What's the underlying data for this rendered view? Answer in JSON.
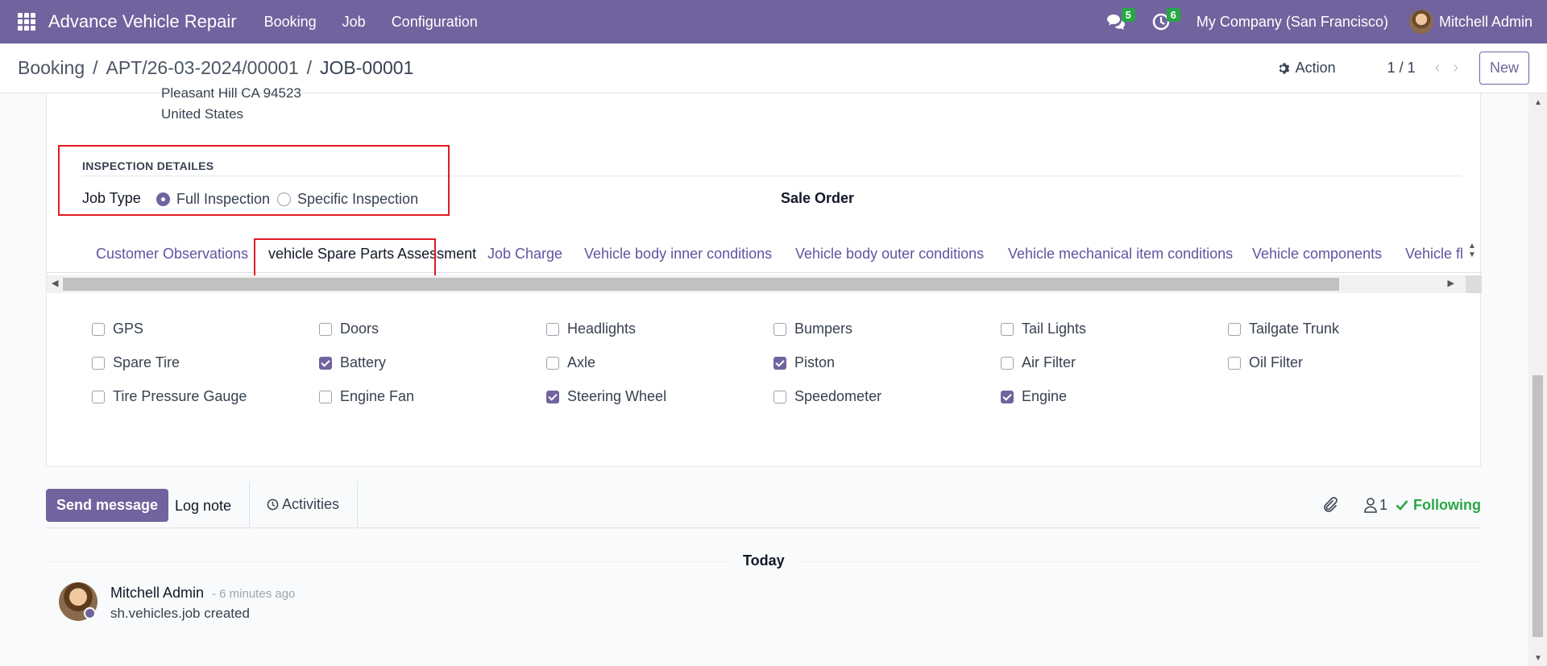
{
  "navbar": {
    "brand": "Advance Vehicle Repair",
    "menus": [
      "Booking",
      "Job",
      "Configuration"
    ],
    "messages_count": "5",
    "activities_count": "6",
    "company": "My Company (San Francisco)",
    "user": "Mitchell Admin"
  },
  "breadcrumb": {
    "items": [
      "Booking",
      "APT/26-03-2024/00001",
      "JOB-00001"
    ],
    "separator": "/"
  },
  "control": {
    "action_label": "Action",
    "pager": "1 / 1",
    "new_label": "New"
  },
  "address": {
    "line1": "Pleasant Hill CA 94523",
    "line2": "United States"
  },
  "inspection": {
    "title": "INSPECTION DETAILES",
    "job_type_label": "Job Type",
    "options": [
      "Full Inspection",
      "Specific Inspection"
    ],
    "selected": "Full Inspection",
    "sale_order_label": "Sale Order"
  },
  "tabs": [
    "Customer Observations",
    "vehicle Spare Parts Assessment",
    "Job Charge",
    "Vehicle body inner conditions",
    "Vehicle body outer conditions",
    "Vehicle mechanical item conditions",
    "Vehicle components",
    "Vehicle fl"
  ],
  "active_tab": "vehicle Spare Parts Assessment",
  "parts": [
    {
      "label": "GPS",
      "checked": false
    },
    {
      "label": "Doors",
      "checked": false
    },
    {
      "label": "Headlights",
      "checked": false
    },
    {
      "label": "Bumpers",
      "checked": false
    },
    {
      "label": "Tail Lights",
      "checked": false
    },
    {
      "label": "Tailgate Trunk",
      "checked": false
    },
    {
      "label": "Spare Tire",
      "checked": false
    },
    {
      "label": "Battery",
      "checked": true
    },
    {
      "label": "Axle",
      "checked": false
    },
    {
      "label": "Piston",
      "checked": true
    },
    {
      "label": "Air Filter",
      "checked": false
    },
    {
      "label": "Oil Filter",
      "checked": false
    },
    {
      "label": "Tire Pressure Gauge",
      "checked": false
    },
    {
      "label": "Engine Fan",
      "checked": false
    },
    {
      "label": "Steering Wheel",
      "checked": true
    },
    {
      "label": "Speedometer",
      "checked": false
    },
    {
      "label": "Engine",
      "checked": true
    }
  ],
  "chatter": {
    "send_message": "Send message",
    "log_note": "Log note",
    "activities": "Activities",
    "followers_count": "1",
    "following": "Following",
    "today": "Today",
    "message": {
      "author": "Mitchell Admin",
      "time": "- 6 minutes ago",
      "body": "sh.vehicles.job created"
    }
  },
  "colors": {
    "brand": "#71639e",
    "highlight": "#e01b24",
    "following": "#28a745"
  }
}
